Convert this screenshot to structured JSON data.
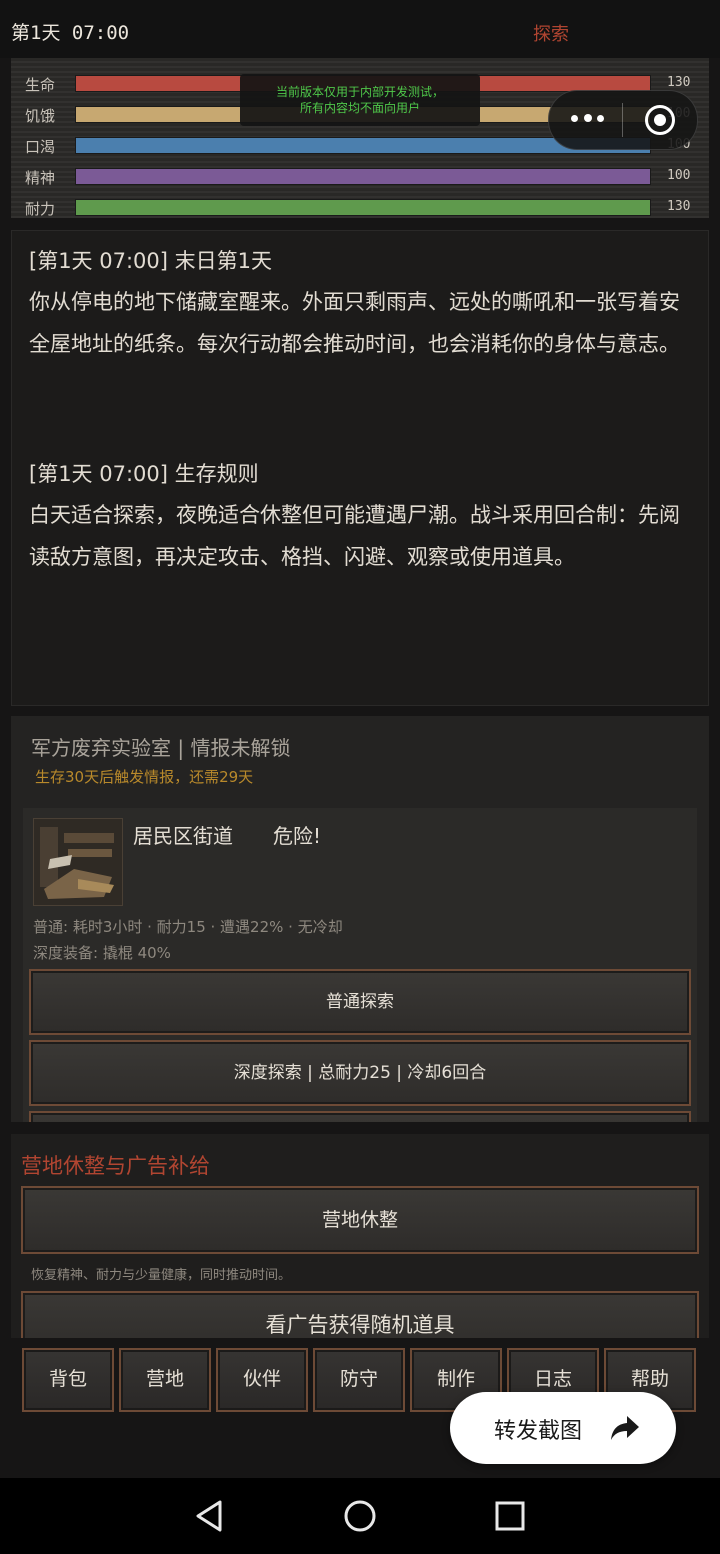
{
  "status": {
    "day_time": "第1天 07:00",
    "phase": "探索"
  },
  "stats": [
    {
      "label": "生命",
      "value": "130",
      "fill": 1.0,
      "color": "#b84a40"
    },
    {
      "label": "饥饿",
      "value": "100",
      "fill": 1.0,
      "color": "#c7a871"
    },
    {
      "label": "口渴",
      "value": "100",
      "fill": 1.0,
      "color": "#4b7fae"
    },
    {
      "label": "精神",
      "value": "100",
      "fill": 1.0,
      "color": "#7b5a96"
    },
    {
      "label": "耐力",
      "value": "130",
      "fill": 1.0,
      "color": "#5f9a4d"
    }
  ],
  "dev_notice": {
    "line1": "当前版本仅用于内部开发测试，",
    "line2": "所有内容均不面向用户"
  },
  "log": [
    {
      "title": "[第1天 07:00] 末日第1天",
      "text": "你从停电的地下储藏室醒来。外面只剩雨声、远处的嘶吼和一张写着安全屋地址的纸条。每次行动都会推动时间，也会消耗你的身体与意志。"
    },
    {
      "title": "[第1天 07:00] 生存规则",
      "text": "白天适合探索，夜晚适合休整但可能遭遇尸潮。战斗采用回合制：先阅读敌方意图，再决定攻击、格挡、闪避、观察或使用道具。"
    }
  ],
  "explore": {
    "intel_title": "军方废弃实验室 | 情报未解锁",
    "intel_sub": "生存30天后触发情报，还需29天",
    "location": {
      "name": "居民区街道",
      "danger": "危险!"
    },
    "info_normal": "普通: 耗时3小时 · 耐力15 · 遭遇22% · 无冷却",
    "info_deep": "深度装备: 撬棍 40%",
    "btn_normal": "普通探索",
    "btn_deep": "深度探索 | 总耐力25 | 冷却6回合"
  },
  "camp": {
    "title": "营地休整与广告补给",
    "btn_rest": "营地休整",
    "rest_note": "恢复精神、耐力与少量健康，同时推动时间。",
    "btn_ad": "看广告获得随机道具"
  },
  "tabs": [
    "背包",
    "营地",
    "伙伴",
    "防守",
    "制作",
    "日志",
    "帮助"
  ],
  "share": {
    "label": "转发截图",
    "icon": "share-arrow-icon"
  }
}
